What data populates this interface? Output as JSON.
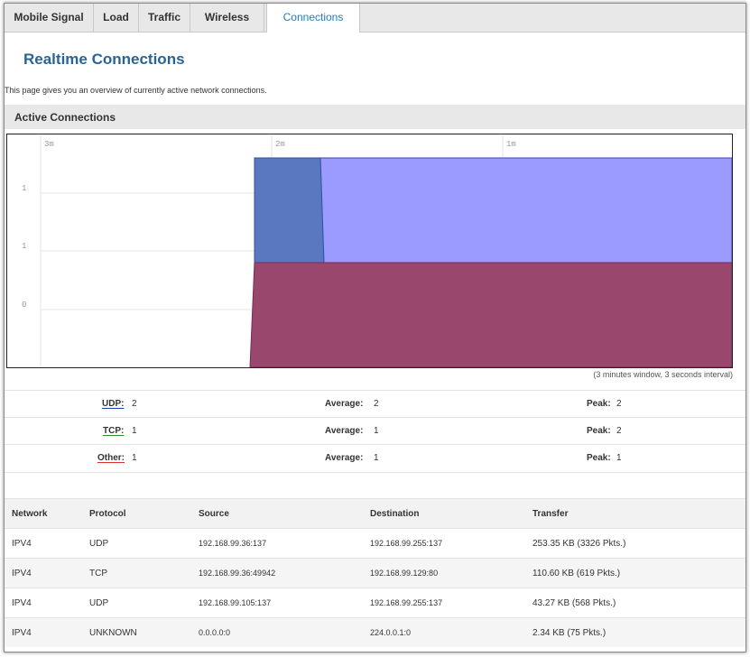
{
  "tabs": [
    {
      "label": "Mobile Signal",
      "active": false
    },
    {
      "label": "Load",
      "active": false
    },
    {
      "label": "Traffic",
      "active": false
    },
    {
      "label": "Wireless",
      "active": false
    },
    {
      "label": "Connections",
      "active": true
    }
  ],
  "page": {
    "title": "Realtime Connections",
    "description": "This page gives you an overview of currently active network connections."
  },
  "section": {
    "title": "Active Connections"
  },
  "chart_data": {
    "type": "area",
    "x_tick_labels": [
      "3m",
      "2m",
      "1m"
    ],
    "y_tick_labels": [
      "1",
      "1",
      "0"
    ],
    "note": "(3 minutes window, 3 seconds interval)",
    "series": [
      {
        "name": "UDP",
        "color": "#0000ff",
        "values_note": "rises to 2 at ~2m mark"
      },
      {
        "name": "TCP",
        "color": "#008000",
        "values_note": "short peak of 2 then 1"
      },
      {
        "name": "Other",
        "color": "#ff0000",
        "values_note": "steady 1"
      }
    ]
  },
  "stats": [
    {
      "protocol": "UDP:",
      "current": "2",
      "avg_label": "Average:",
      "average": "2",
      "peak_label": "Peak:",
      "peak": "2",
      "color": "#1f3fb5"
    },
    {
      "protocol": "TCP:",
      "current": "1",
      "avg_label": "Average:",
      "average": "1",
      "peak_label": "Peak:",
      "peak": "2",
      "color": "#2e8b2e"
    },
    {
      "protocol": "Other:",
      "current": "1",
      "avg_label": "Average:",
      "average": "1",
      "peak_label": "Peak:",
      "peak": "1",
      "color": "#d9302c"
    }
  ],
  "table": {
    "headers": [
      "Network",
      "Protocol",
      "Source",
      "Destination",
      "Transfer"
    ],
    "rows": [
      [
        "IPV4",
        "UDP",
        "192.168.99.36:137",
        "192.168.99.255:137",
        "253.35 KB (3326 Pkts.)"
      ],
      [
        "IPV4",
        "TCP",
        "192.168.99.36:49942",
        "192.168.99.129:80",
        "110.60 KB (619 Pkts.)"
      ],
      [
        "IPV4",
        "UDP",
        "192.168.99.105:137",
        "192.168.99.255:137",
        "43.27 KB (568 Pkts.)"
      ],
      [
        "IPV4",
        "UNKNOWN",
        "0.0.0.0:0",
        "224.0.0.1:0",
        "2.34 KB (75 Pkts.)"
      ]
    ]
  }
}
